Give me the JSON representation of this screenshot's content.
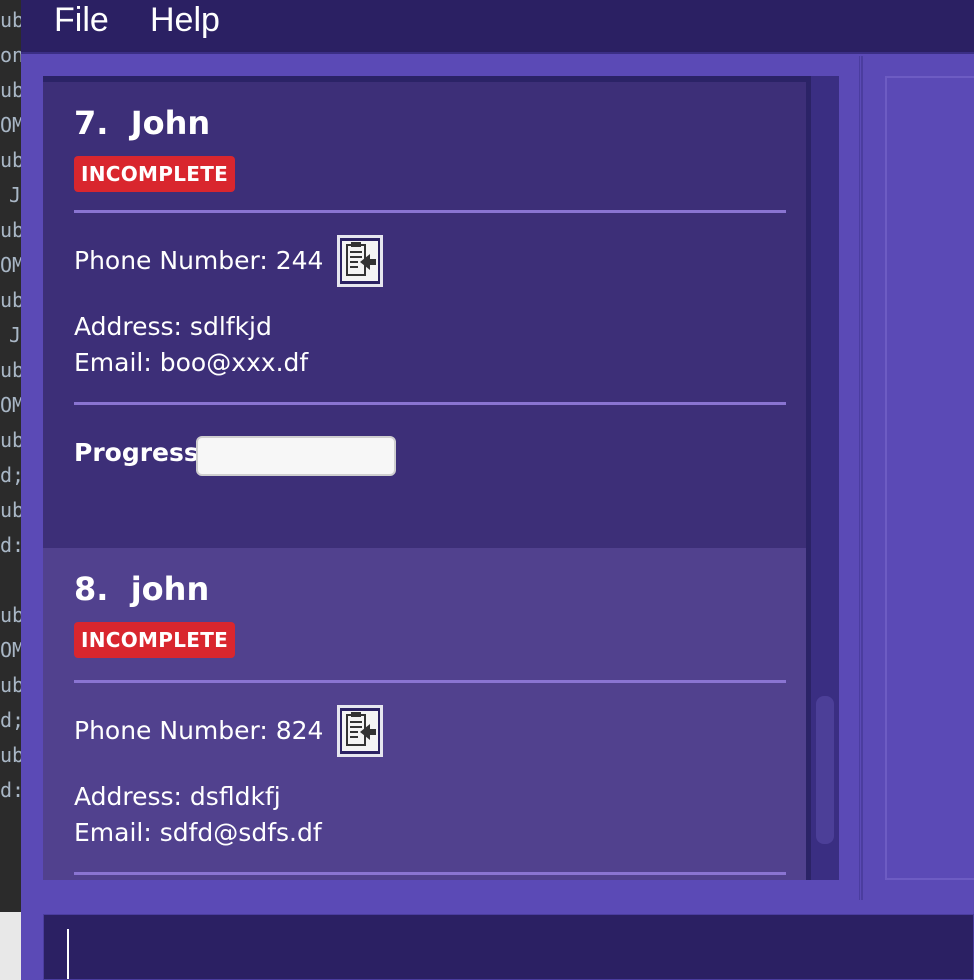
{
  "menu": {
    "file": "File",
    "help": "Help"
  },
  "persons": [
    {
      "index": "7.",
      "name": "John",
      "status": "INCOMPLETE",
      "phone": "Phone Number: 244",
      "address": "Address: sdlfkjd",
      "email": "Email: boo@xxx.df",
      "progress_label": "Progress:",
      "progress_fraction": 0
    },
    {
      "index": "8.",
      "name": "john",
      "status": "INCOMPLETE",
      "phone": "Phone Number: 824",
      "address": "Address: dsfldkfj",
      "email": "Email: sdfd@sdfs.df"
    }
  ],
  "bg_code_fragments": [
    "ub",
    "on",
    "ub",
    "OM",
    "ub",
    "J",
    "ub",
    "OM",
    "ub",
    "J",
    "ub",
    "OM",
    "ub",
    "d;",
    "ub",
    "d:",
    "",
    "ub",
    "OM",
    "ub",
    "d;",
    "ub",
    "d:"
  ],
  "colors": {
    "menubar": "#2b2063",
    "panel": "#5b4ab6",
    "card_odd": "#3d2f78",
    "card_even": "#51418e",
    "badge_incomplete": "#d9262e"
  },
  "icons": {
    "copy": "copy-clipboard-icon"
  },
  "command_box": {
    "value": ""
  }
}
